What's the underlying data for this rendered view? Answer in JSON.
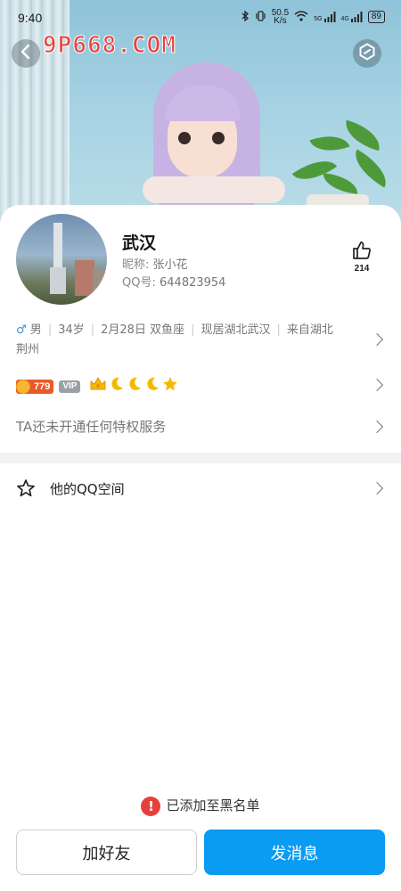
{
  "status_bar": {
    "time": "9:40",
    "speed_value": "50.5",
    "speed_unit": "K/s",
    "signal1_label": "5G",
    "signal2_label": "4G",
    "battery": "89"
  },
  "watermark": "9P668.COM",
  "profile": {
    "name": "武汉",
    "nickname_label": "昵称:",
    "nickname": "张小花",
    "qq_label": "QQ号:",
    "qq_number": "644823954",
    "likes": "214"
  },
  "info": {
    "gender_symbol": "♂",
    "gender": "男",
    "age": "34岁",
    "birthday": "2月28日",
    "zodiac": "双鱼座",
    "residence": "现居湖北武汉",
    "hometown": "来自湖北荆州"
  },
  "badges": {
    "coin_value": "779",
    "vip_label": "VIP"
  },
  "privilege_text": "TA还未开通任何特权服务",
  "qzone_label": "他的QQ空间",
  "blacklist_notice": "已添加至黑名单",
  "buttons": {
    "add_friend": "加好友",
    "send_message": "发消息"
  },
  "colors": {
    "primary": "#0a9bf3",
    "alert": "#e6403a",
    "gender": "#3a8ee6"
  }
}
